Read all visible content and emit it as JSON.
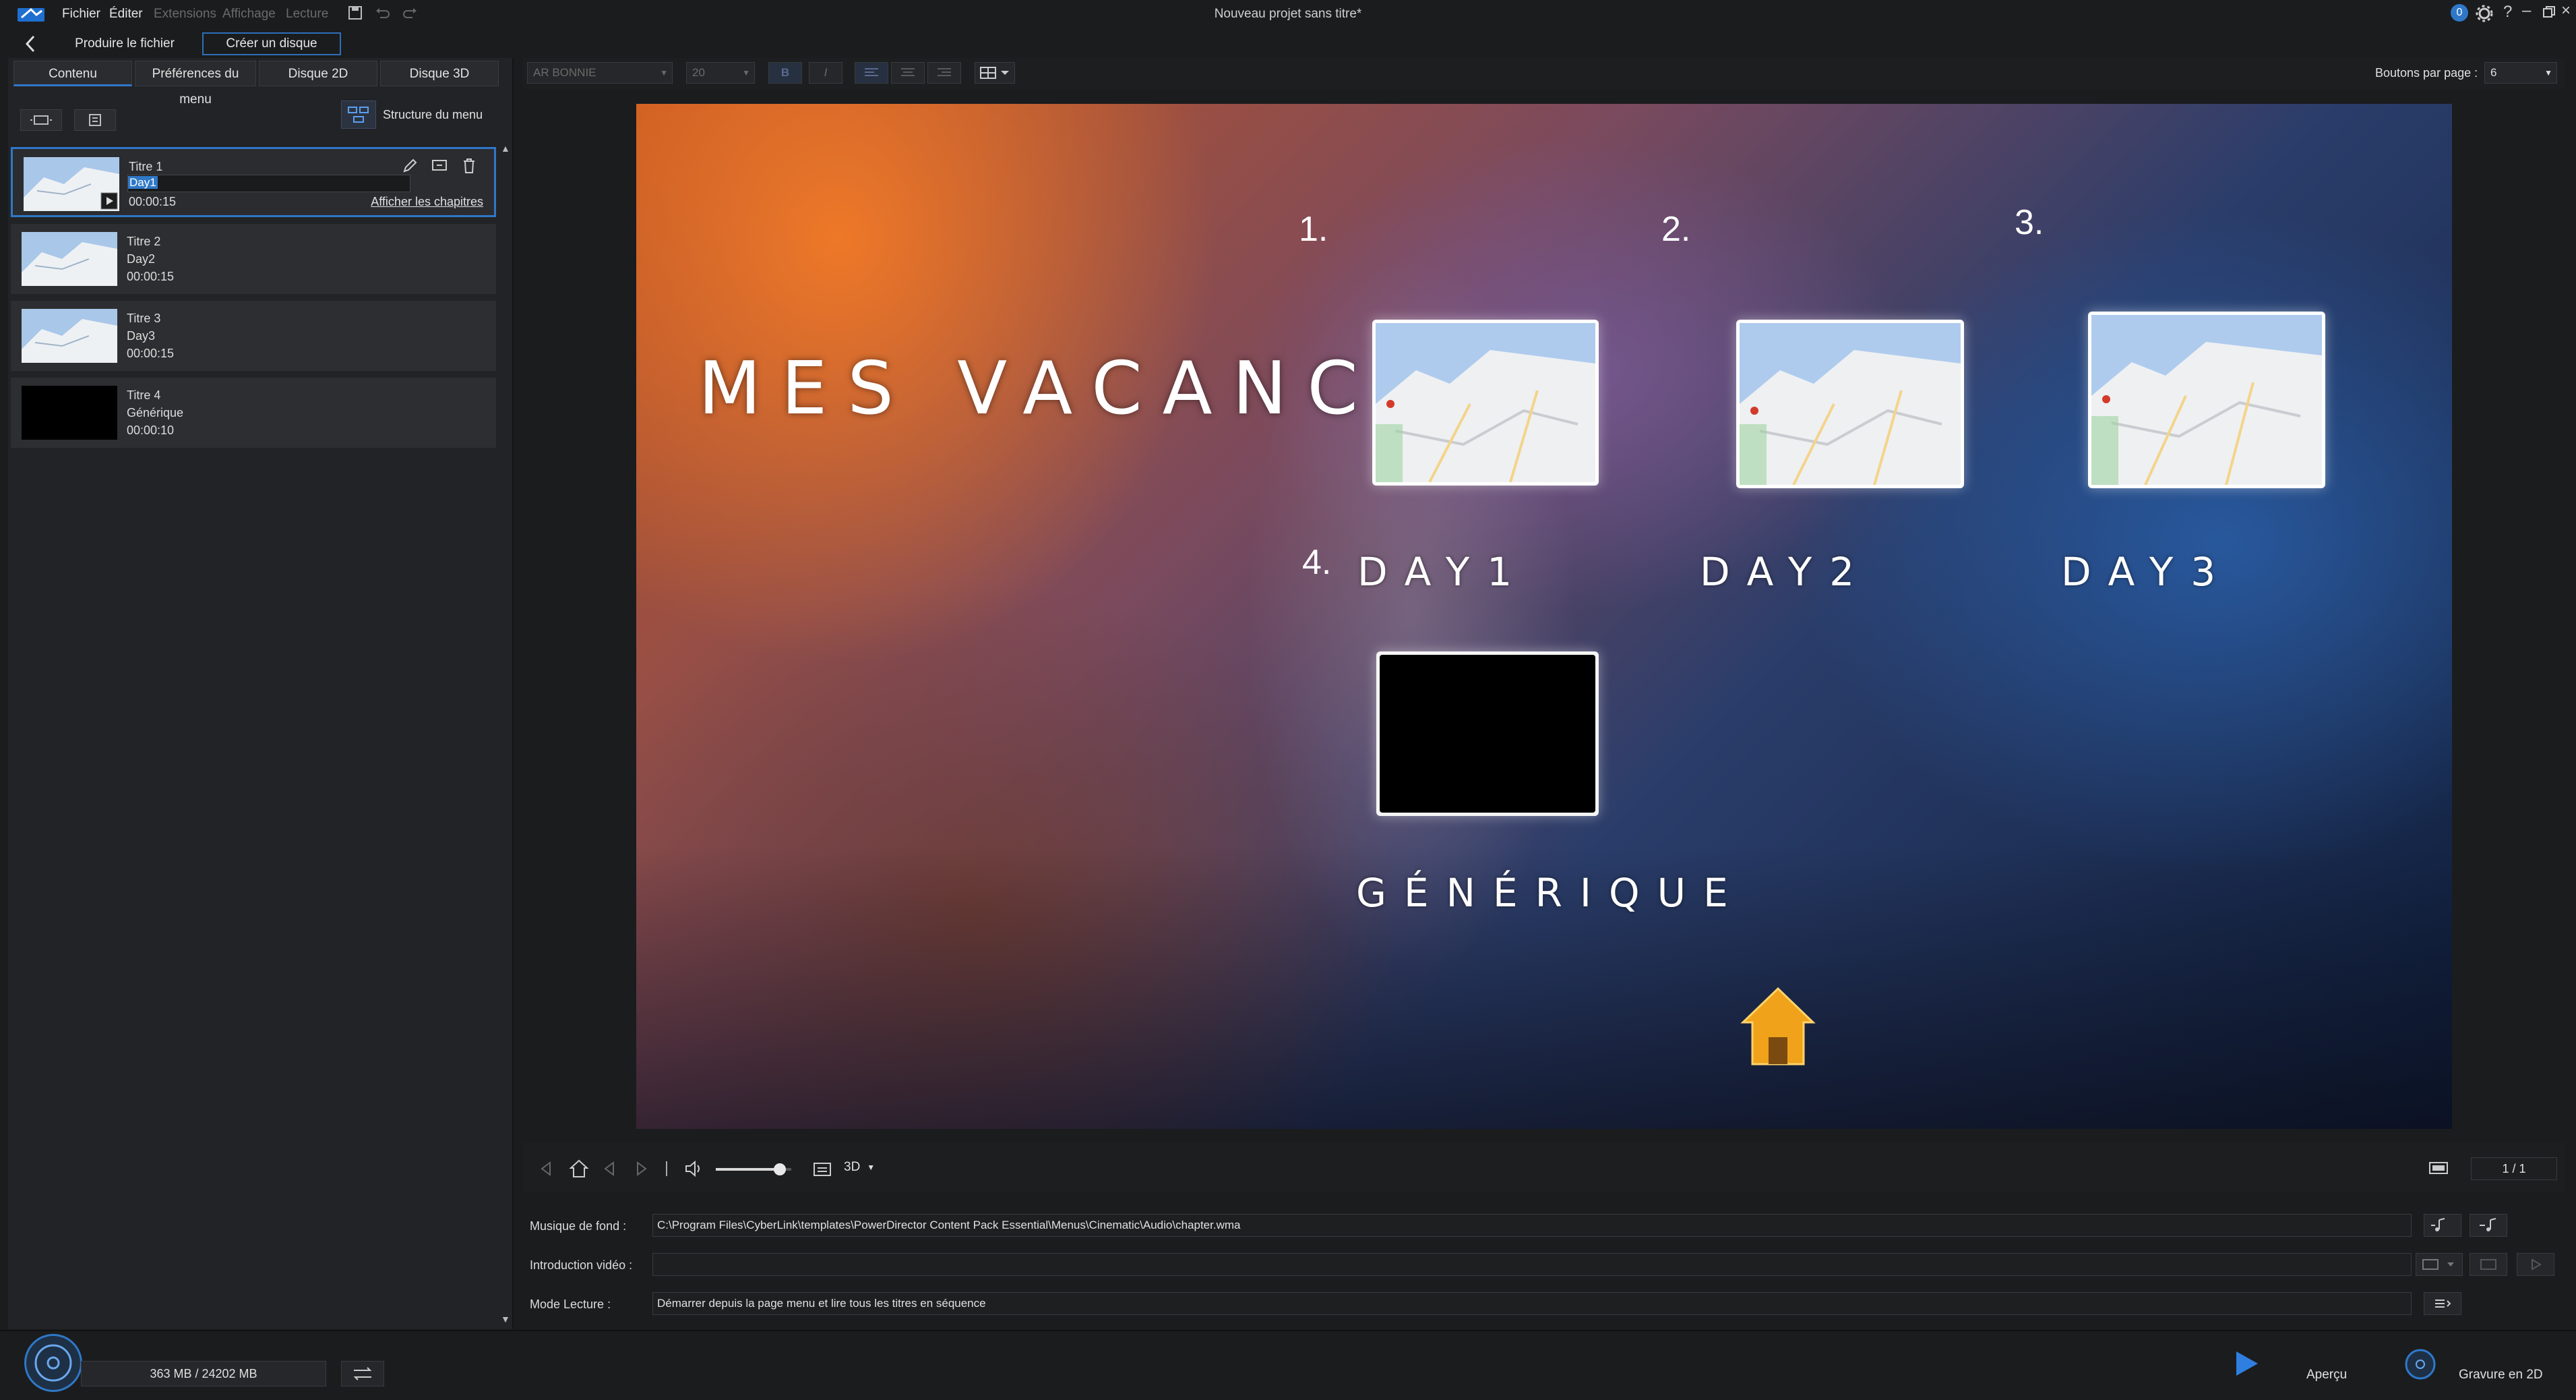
{
  "app": {
    "window_title": "Nouveau projet sans titre*",
    "menu": [
      "Fichier",
      "Éditer",
      "Extensions",
      "Affichage",
      "Lecture"
    ],
    "notification_count": "0"
  },
  "top_buttons": {
    "produce": "Produire le fichier",
    "create_disc": "Créer un disque"
  },
  "tabs": [
    "Contenu",
    "Préférences du menu",
    "Disque 2D",
    "Disque 3D"
  ],
  "left": {
    "menu_structure_label": "Structure du menu",
    "show_chapters": "Afficher les chapitres",
    "titles": [
      {
        "title": "Titre 1",
        "subtitle": "Day1",
        "duration": "00:00:15"
      },
      {
        "title": "Titre 2",
        "subtitle": "Day2",
        "duration": "00:00:15"
      },
      {
        "title": "Titre 3",
        "subtitle": "Day3",
        "duration": "00:00:15"
      },
      {
        "title": "Titre 4",
        "subtitle": "Générique",
        "duration": "00:00:10"
      }
    ]
  },
  "format_bar": {
    "font": "AR BONNIE",
    "size": "20",
    "buttons_per_page_label": "Boutons par page :",
    "buttons_per_page_value": "6"
  },
  "menu_preview": {
    "title": "MES VACANCES",
    "items": [
      {
        "num": "1.",
        "label": "DAY1"
      },
      {
        "num": "2.",
        "label": "DAY2"
      },
      {
        "num": "3.",
        "label": "DAY3"
      },
      {
        "num": "4.",
        "label": "GÉNÉRIQUE"
      }
    ]
  },
  "playback": {
    "mode": "3D",
    "page": "1 / 1",
    "volume": 0.85
  },
  "settings": {
    "music_label": "Musique de fond :",
    "music_value": "C:\\Program Files\\CyberLink\\templates\\PowerDirector Content Pack Essential\\Menus\\Cinematic\\Audio\\chapter.wma",
    "intro_label": "Introduction vidéo :",
    "intro_value": "",
    "mode_label": "Mode Lecture :",
    "mode_value": "Démarrer depuis la page menu et lire tous les titres en séquence"
  },
  "bottom": {
    "disc_usage": "363 MB / 24202 MB",
    "preview_label": "Aperçu",
    "burn_label": "Gravure en 2D"
  },
  "colors": {
    "accent": "#2f78c8",
    "background": "#1b1c1e",
    "panel": "#222326"
  }
}
